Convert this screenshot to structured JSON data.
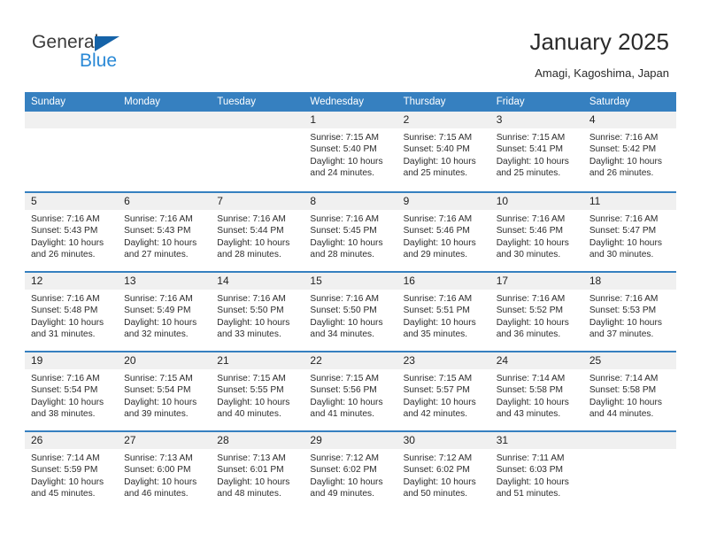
{
  "brand": {
    "name_part1": "General",
    "name_part2": "Blue",
    "triangle_color": "#1563a8",
    "blue_color": "#2a89d6"
  },
  "header": {
    "title": "January 2025",
    "subtitle": "Amagi, Kagoshima, Japan"
  },
  "theme": {
    "header_blue": "#3680c0",
    "date_band_gray": "#f0f0f0",
    "text_color": "#2c2c2c"
  },
  "calendar": {
    "weekdays": [
      "Sunday",
      "Monday",
      "Tuesday",
      "Wednesday",
      "Thursday",
      "Friday",
      "Saturday"
    ],
    "weeks": [
      [
        {
          "date": "",
          "lines": []
        },
        {
          "date": "",
          "lines": []
        },
        {
          "date": "",
          "lines": []
        },
        {
          "date": "1",
          "lines": [
            "Sunrise: 7:15 AM",
            "Sunset: 5:40 PM",
            "Daylight: 10 hours",
            "and 24 minutes."
          ]
        },
        {
          "date": "2",
          "lines": [
            "Sunrise: 7:15 AM",
            "Sunset: 5:40 PM",
            "Daylight: 10 hours",
            "and 25 minutes."
          ]
        },
        {
          "date": "3",
          "lines": [
            "Sunrise: 7:15 AM",
            "Sunset: 5:41 PM",
            "Daylight: 10 hours",
            "and 25 minutes."
          ]
        },
        {
          "date": "4",
          "lines": [
            "Sunrise: 7:16 AM",
            "Sunset: 5:42 PM",
            "Daylight: 10 hours",
            "and 26 minutes."
          ]
        }
      ],
      [
        {
          "date": "5",
          "lines": [
            "Sunrise: 7:16 AM",
            "Sunset: 5:43 PM",
            "Daylight: 10 hours",
            "and 26 minutes."
          ]
        },
        {
          "date": "6",
          "lines": [
            "Sunrise: 7:16 AM",
            "Sunset: 5:43 PM",
            "Daylight: 10 hours",
            "and 27 minutes."
          ]
        },
        {
          "date": "7",
          "lines": [
            "Sunrise: 7:16 AM",
            "Sunset: 5:44 PM",
            "Daylight: 10 hours",
            "and 28 minutes."
          ]
        },
        {
          "date": "8",
          "lines": [
            "Sunrise: 7:16 AM",
            "Sunset: 5:45 PM",
            "Daylight: 10 hours",
            "and 28 minutes."
          ]
        },
        {
          "date": "9",
          "lines": [
            "Sunrise: 7:16 AM",
            "Sunset: 5:46 PM",
            "Daylight: 10 hours",
            "and 29 minutes."
          ]
        },
        {
          "date": "10",
          "lines": [
            "Sunrise: 7:16 AM",
            "Sunset: 5:46 PM",
            "Daylight: 10 hours",
            "and 30 minutes."
          ]
        },
        {
          "date": "11",
          "lines": [
            "Sunrise: 7:16 AM",
            "Sunset: 5:47 PM",
            "Daylight: 10 hours",
            "and 30 minutes."
          ]
        }
      ],
      [
        {
          "date": "12",
          "lines": [
            "Sunrise: 7:16 AM",
            "Sunset: 5:48 PM",
            "Daylight: 10 hours",
            "and 31 minutes."
          ]
        },
        {
          "date": "13",
          "lines": [
            "Sunrise: 7:16 AM",
            "Sunset: 5:49 PM",
            "Daylight: 10 hours",
            "and 32 minutes."
          ]
        },
        {
          "date": "14",
          "lines": [
            "Sunrise: 7:16 AM",
            "Sunset: 5:50 PM",
            "Daylight: 10 hours",
            "and 33 minutes."
          ]
        },
        {
          "date": "15",
          "lines": [
            "Sunrise: 7:16 AM",
            "Sunset: 5:50 PM",
            "Daylight: 10 hours",
            "and 34 minutes."
          ]
        },
        {
          "date": "16",
          "lines": [
            "Sunrise: 7:16 AM",
            "Sunset: 5:51 PM",
            "Daylight: 10 hours",
            "and 35 minutes."
          ]
        },
        {
          "date": "17",
          "lines": [
            "Sunrise: 7:16 AM",
            "Sunset: 5:52 PM",
            "Daylight: 10 hours",
            "and 36 minutes."
          ]
        },
        {
          "date": "18",
          "lines": [
            "Sunrise: 7:16 AM",
            "Sunset: 5:53 PM",
            "Daylight: 10 hours",
            "and 37 minutes."
          ]
        }
      ],
      [
        {
          "date": "19",
          "lines": [
            "Sunrise: 7:16 AM",
            "Sunset: 5:54 PM",
            "Daylight: 10 hours",
            "and 38 minutes."
          ]
        },
        {
          "date": "20",
          "lines": [
            "Sunrise: 7:15 AM",
            "Sunset: 5:54 PM",
            "Daylight: 10 hours",
            "and 39 minutes."
          ]
        },
        {
          "date": "21",
          "lines": [
            "Sunrise: 7:15 AM",
            "Sunset: 5:55 PM",
            "Daylight: 10 hours",
            "and 40 minutes."
          ]
        },
        {
          "date": "22",
          "lines": [
            "Sunrise: 7:15 AM",
            "Sunset: 5:56 PM",
            "Daylight: 10 hours",
            "and 41 minutes."
          ]
        },
        {
          "date": "23",
          "lines": [
            "Sunrise: 7:15 AM",
            "Sunset: 5:57 PM",
            "Daylight: 10 hours",
            "and 42 minutes."
          ]
        },
        {
          "date": "24",
          "lines": [
            "Sunrise: 7:14 AM",
            "Sunset: 5:58 PM",
            "Daylight: 10 hours",
            "and 43 minutes."
          ]
        },
        {
          "date": "25",
          "lines": [
            "Sunrise: 7:14 AM",
            "Sunset: 5:58 PM",
            "Daylight: 10 hours",
            "and 44 minutes."
          ]
        }
      ],
      [
        {
          "date": "26",
          "lines": [
            "Sunrise: 7:14 AM",
            "Sunset: 5:59 PM",
            "Daylight: 10 hours",
            "and 45 minutes."
          ]
        },
        {
          "date": "27",
          "lines": [
            "Sunrise: 7:13 AM",
            "Sunset: 6:00 PM",
            "Daylight: 10 hours",
            "and 46 minutes."
          ]
        },
        {
          "date": "28",
          "lines": [
            "Sunrise: 7:13 AM",
            "Sunset: 6:01 PM",
            "Daylight: 10 hours",
            "and 48 minutes."
          ]
        },
        {
          "date": "29",
          "lines": [
            "Sunrise: 7:12 AM",
            "Sunset: 6:02 PM",
            "Daylight: 10 hours",
            "and 49 minutes."
          ]
        },
        {
          "date": "30",
          "lines": [
            "Sunrise: 7:12 AM",
            "Sunset: 6:02 PM",
            "Daylight: 10 hours",
            "and 50 minutes."
          ]
        },
        {
          "date": "31",
          "lines": [
            "Sunrise: 7:11 AM",
            "Sunset: 6:03 PM",
            "Daylight: 10 hours",
            "and 51 minutes."
          ]
        },
        {
          "date": "",
          "lines": []
        }
      ]
    ]
  }
}
